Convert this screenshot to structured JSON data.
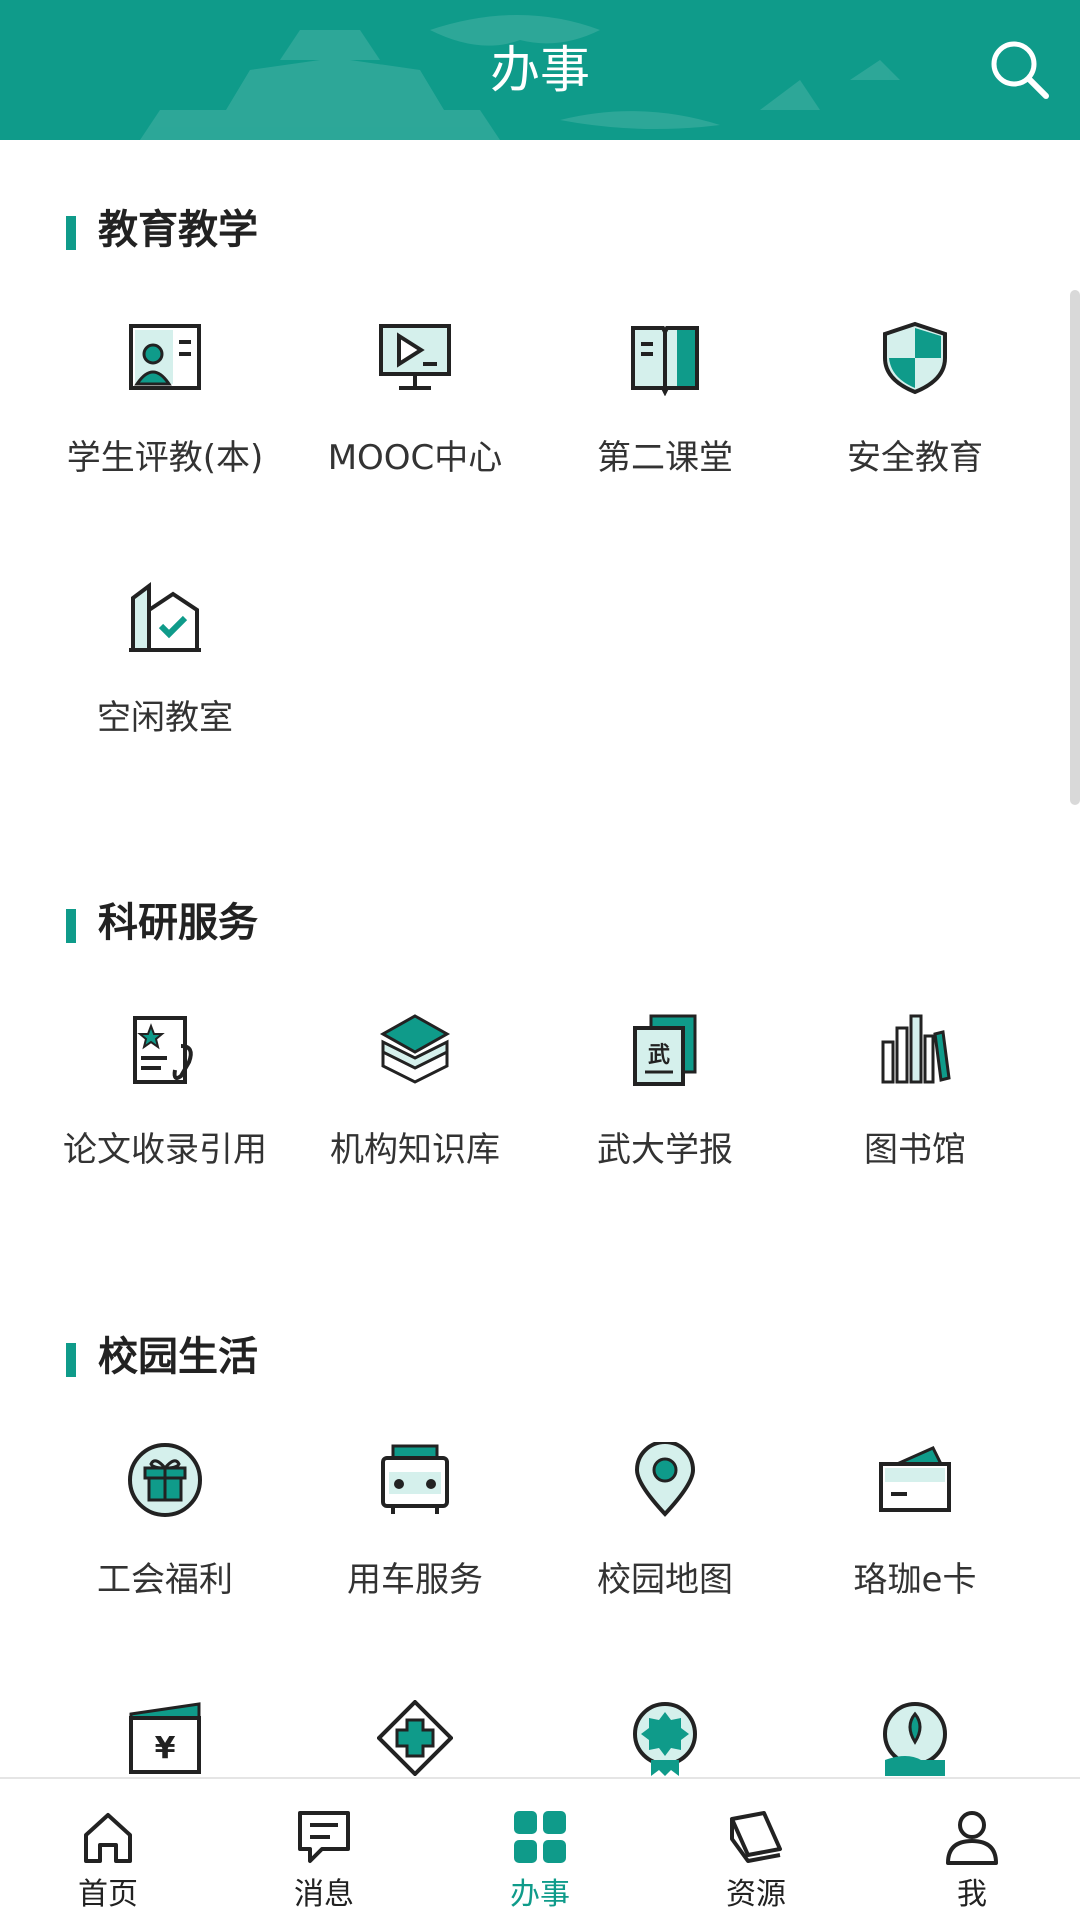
{
  "colors": {
    "accent": "#0f9b8a",
    "accent_light": "#d5f0ec",
    "text": "#222222"
  },
  "header": {
    "title": "办事",
    "search_icon": "search-icon"
  },
  "sections": [
    {
      "title": "教育教学",
      "items": [
        {
          "label": "学生评教(本)",
          "icon": "student-card-icon"
        },
        {
          "label": "MOOC中心",
          "icon": "video-monitor-icon"
        },
        {
          "label": "第二课堂",
          "icon": "open-book-icon"
        },
        {
          "label": "安全教育",
          "icon": "shield-icon"
        },
        {
          "label": "空闲教室",
          "icon": "building-check-icon"
        }
      ]
    },
    {
      "title": "科研服务",
      "items": [
        {
          "label": "论文收录引用",
          "icon": "paper-star-icon"
        },
        {
          "label": "机构知识库",
          "icon": "layers-icon"
        },
        {
          "label": "武大学报",
          "icon": "journal-icon"
        },
        {
          "label": "图书馆",
          "icon": "bookshelf-icon"
        }
      ]
    },
    {
      "title": "校园生活",
      "items": [
        {
          "label": "工会福利",
          "icon": "gift-icon"
        },
        {
          "label": "用车服务",
          "icon": "bus-icon"
        },
        {
          "label": "校园地图",
          "icon": "map-pin-icon"
        },
        {
          "label": "珞珈e卡",
          "icon": "card-icon"
        },
        {
          "label": "",
          "icon": "yuan-wallet-icon"
        },
        {
          "label": "",
          "icon": "medical-cross-icon"
        },
        {
          "label": "",
          "icon": "badge-icon"
        },
        {
          "label": "",
          "icon": "globe-hand-icon"
        }
      ]
    }
  ],
  "tabbar": [
    {
      "label": "首页",
      "icon": "home-icon",
      "active": false
    },
    {
      "label": "消息",
      "icon": "message-icon",
      "active": false
    },
    {
      "label": "办事",
      "icon": "grid-icon",
      "active": true
    },
    {
      "label": "资源",
      "icon": "book-stack-icon",
      "active": false
    },
    {
      "label": "我",
      "icon": "user-icon",
      "active": false
    }
  ]
}
